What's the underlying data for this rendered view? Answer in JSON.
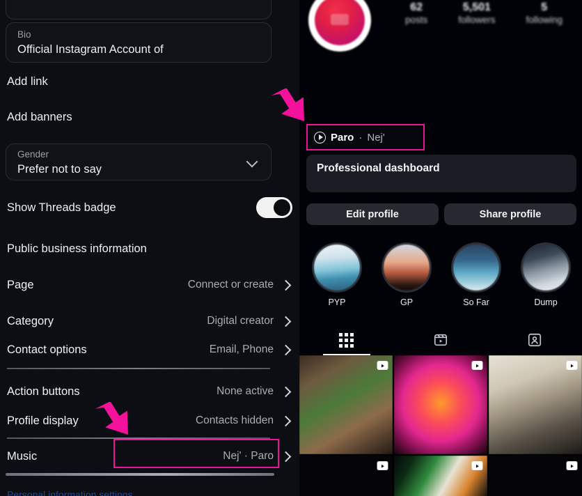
{
  "left_panel": {
    "bio_field": {
      "label": "Bio",
      "value": "Official Instagram Account of"
    },
    "add_link": "Add link",
    "add_banners": "Add banners",
    "gender_field": {
      "label": "Gender",
      "value": "Prefer not to say"
    },
    "threads_badge": {
      "label": "Show Threads badge",
      "state": "on"
    },
    "public_business_information": "Public business information",
    "rows": [
      {
        "label": "Page",
        "value": "Connect or create"
      },
      {
        "label": "Category",
        "value": "Digital creator"
      },
      {
        "label": "Contact options",
        "value": "Email, Phone"
      },
      {
        "label": "Action buttons",
        "value": "None active"
      },
      {
        "label": "Profile display",
        "value": "Contacts hidden"
      },
      {
        "label": "Music",
        "value": "Nej' · Paro"
      }
    ],
    "bottom_hint": "Personal information settings"
  },
  "right_panel": {
    "stats": [
      {
        "num": "62",
        "label": "posts"
      },
      {
        "num": "5,501",
        "label": "followers"
      },
      {
        "num": "5",
        "label": "following"
      }
    ],
    "music_chip": {
      "title": "Paro",
      "separator": "·",
      "artist": "Nej'"
    },
    "professional_dashboard": "Professional dashboard",
    "buttons": [
      "Edit profile",
      "Share profile"
    ],
    "highlights": [
      {
        "caption": "PYP"
      },
      {
        "caption": "GP"
      },
      {
        "caption": "So Far"
      },
      {
        "caption": "Dump"
      }
    ],
    "tabs": [
      {
        "name": "grid-tab",
        "icon": "grid-icon",
        "active": true
      },
      {
        "name": "reels-tab",
        "icon": "reels-icon",
        "active": false
      },
      {
        "name": "tagged-tab",
        "icon": "tagged-icon",
        "active": false
      }
    ]
  },
  "annotations": {
    "accent_color": "#ec1497",
    "arrows": [
      {
        "name": "arrow-to-music-chip"
      },
      {
        "name": "arrow-to-music-row"
      }
    ],
    "highlight_boxes": [
      {
        "name": "music-chip-highlight"
      },
      {
        "name": "music-row-highlight"
      }
    ]
  }
}
